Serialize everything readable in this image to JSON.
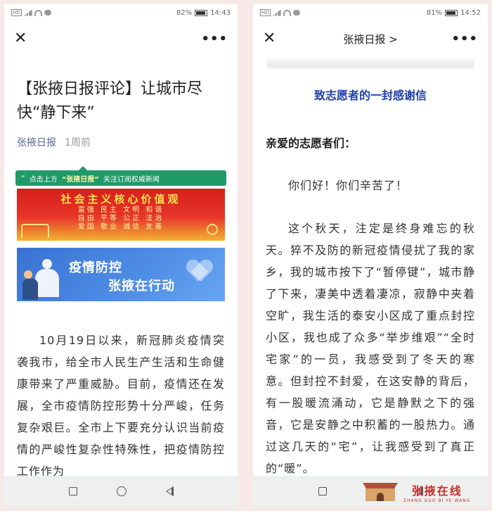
{
  "left": {
    "status": {
      "network": "HD",
      "battery": "82%",
      "time": "14:43"
    },
    "title": "【张掖日报评论】让城市尽快“静下来”",
    "source": "张掖日报",
    "time_ago": "1周前",
    "subscribe_bar": {
      "icon": "“",
      "pre": "点击上方",
      "highlight": "“张掖日报”",
      "post": "关注订阅权威新闻"
    },
    "values_banner": {
      "title": "社会主义核心价值观",
      "row1": "富强 民主 文明 和谐",
      "row2": "自由 平等 公正 法治",
      "row3": "爱国 敬业 诚信 友善"
    },
    "epidemic_banner": {
      "line1": "疫情防控",
      "line2": "张掖在行动"
    },
    "paragraph": "10月19日以来，新冠肺炎疫情突袭我市，给全市人民生产生活和生命健康带来了严重威胁。目前，疫情还在发展，全市疫情防控形势十分严峻，任务复杂艰巨。全市上下要充分认识当前疫情的严峻性复杂性特殊性，把疫情防控工作作为"
  },
  "right": {
    "status": {
      "network": "HD",
      "battery": "81%",
      "time": "14:52"
    },
    "nav_title": "张掖日报",
    "nav_chevron": ">",
    "letter_title": "致志愿者的一封感谢信",
    "greeting": "亲爱的志愿者们：",
    "paragraph1": "你们好！你们辛苦了！",
    "paragraph2": "这个秋天，注定是终身难忘的秋天。猝不及防的新冠疫情侵扰了我的家乡，我的城市按下了“暂停键”，城市静了下来，凄美中透着凄凉，寂静中夹着空旷，我生活的泰安小区成了重点封控小区，我也成了众多“举步维艰”“全时宅家”的一员，我感受到了冬天的寒意。但封控不封爱，在这安静的背后，有一股暖流涌动，它是静默之下的强音，它是安静之中积蓄的一股热力。通过这几天的“宅”，让我感受到了真正的“暖”。"
  },
  "watermark": {
    "cn": "张掖在线",
    "en": "ZHANG GUO BI YE WANG"
  },
  "colors": {
    "link": "#576b95",
    "subscribe": "#1f9a68",
    "letter_title": "#1f3fa8",
    "background": "#f8e9e9"
  }
}
